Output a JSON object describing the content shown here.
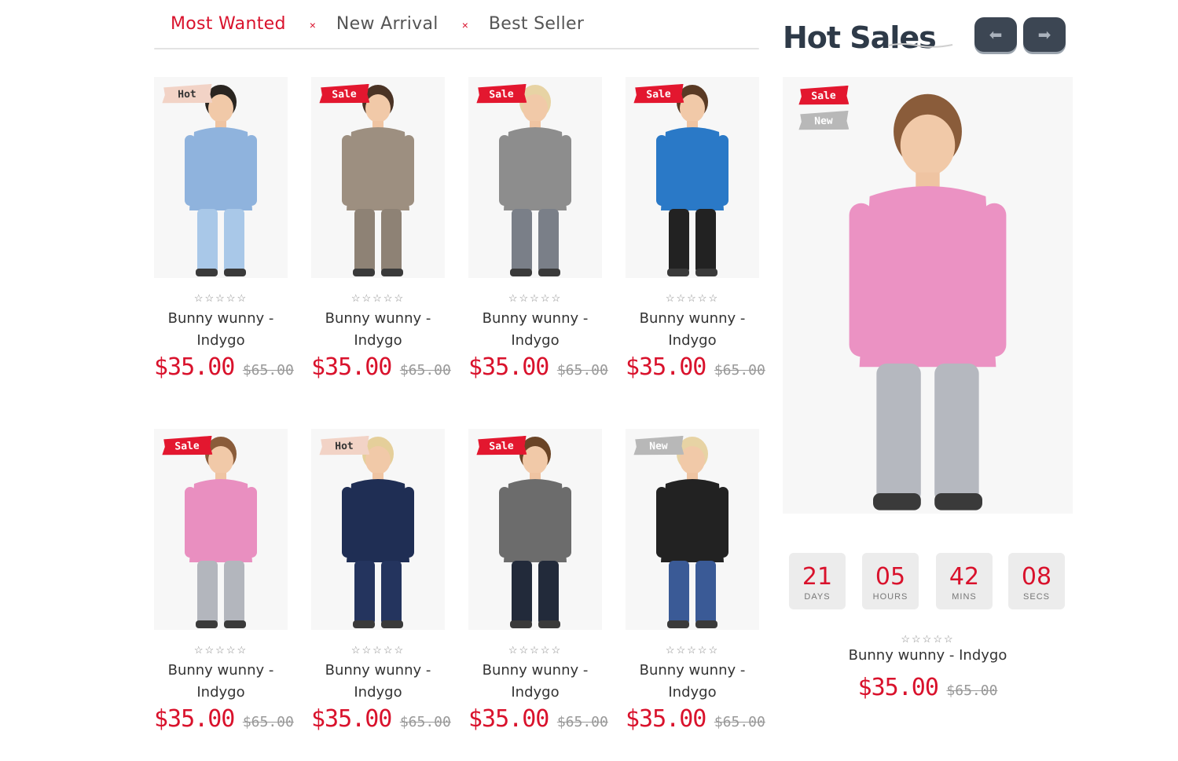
{
  "tabs": {
    "items": [
      "Most Wanted",
      "New Arrival",
      "Best Seller"
    ],
    "active": "Most Wanted",
    "separator": "×"
  },
  "products": [
    {
      "badge": "Hot",
      "name": "Bunny wunny - Indygo",
      "stars": "☆☆☆☆☆",
      "price": "$35.00",
      "old_price": "$65.00"
    },
    {
      "badge": "Sale",
      "name": "Bunny wunny - Indygo",
      "stars": "☆☆☆☆☆",
      "price": "$35.00",
      "old_price": "$65.00"
    },
    {
      "badge": "Sale",
      "name": "Bunny wunny - Indygo",
      "stars": "☆☆☆☆☆",
      "price": "$35.00",
      "old_price": "$65.00"
    },
    {
      "badge": "Sale",
      "name": "Bunny wunny - Indygo",
      "stars": "☆☆☆☆☆",
      "price": "$35.00",
      "old_price": "$65.00"
    },
    {
      "badge": "Sale",
      "name": "Bunny wunny - Indygo",
      "stars": "☆☆☆☆☆",
      "price": "$35.00",
      "old_price": "$65.00"
    },
    {
      "badge": "Hot",
      "name": "Bunny wunny - Indygo",
      "stars": "☆☆☆☆☆",
      "price": "$35.00",
      "old_price": "$65.00"
    },
    {
      "badge": "Sale",
      "name": "Bunny wunny - Indygo",
      "stars": "☆☆☆☆☆",
      "price": "$35.00",
      "old_price": "$65.00"
    },
    {
      "badge": "New",
      "name": "Bunny wunny - Indygo",
      "stars": "☆☆☆☆☆",
      "price": "$35.00",
      "old_price": "$65.00"
    }
  ],
  "hot_sales": {
    "title": "Hot Sales",
    "prev_icon": "arrow-left-icon",
    "next_icon": "arrow-right-icon",
    "badges": [
      "Sale",
      "New"
    ],
    "countdown": [
      {
        "value": "21",
        "label": "DAYS"
      },
      {
        "value": "05",
        "label": "HOURS"
      },
      {
        "value": "42",
        "label": "MINS"
      },
      {
        "value": "08",
        "label": "SECS"
      }
    ],
    "product": {
      "name": "Bunny wunny - Indygo",
      "stars": "☆☆☆☆☆",
      "price": "$35.00",
      "old_price": "$65.00"
    }
  },
  "colors": {
    "accent": "#d9122c",
    "sale_badge": "#e3172f",
    "hot_badge": "#f2d3c6",
    "new_badge": "#b8b8b8",
    "nav_button": "#3c4653",
    "heading": "#2e3a48"
  },
  "photo_palettes": [
    {
      "top": "#8fb3dd",
      "bottom": "#a9c8e8",
      "hair": "#2a2520"
    },
    {
      "top": "#9d8f80",
      "bottom": "#8e8275",
      "hair": "#4a3325"
    },
    {
      "top": "#8d8d8d",
      "bottom": "#7a7f88",
      "hair": "#e7d3a4"
    },
    {
      "top": "#2a79c7",
      "bottom": "#222222",
      "hair": "#5a3a24"
    },
    {
      "top": "#e98fc0",
      "bottom": "#b3b6bd",
      "hair": "#8a5c3a"
    },
    {
      "top": "#1f2e54",
      "bottom": "#24345e",
      "hair": "#e5cf9a"
    },
    {
      "top": "#6c6c6c",
      "bottom": "#222a3a",
      "hair": "#6a4426"
    },
    {
      "top": "#222222",
      "bottom": "#3a5a96",
      "hair": "#e7d3a4"
    }
  ],
  "hot_palette": {
    "top": "#eb92c3",
    "bottom": "#b5b8bf",
    "hair": "#8a5c3a"
  }
}
